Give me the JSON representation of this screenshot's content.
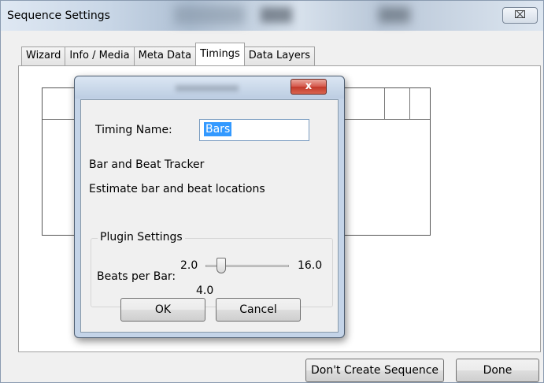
{
  "window": {
    "title": "Sequence Settings",
    "close_glyph": "⌧"
  },
  "tabs": [
    {
      "label": "Wizard",
      "active": false
    },
    {
      "label": "Info / Media",
      "active": false
    },
    {
      "label": "Meta Data",
      "active": false
    },
    {
      "label": "Timings",
      "active": true
    },
    {
      "label": "Data Layers",
      "active": false
    }
  ],
  "footer": {
    "dont_create_label": "Don't Create Sequence",
    "done_label": "Done"
  },
  "dialog": {
    "close_glyph": "x",
    "timing_name_label": "Timing Name:",
    "timing_name_value": "Bars",
    "plugin_name": "Bar and Beat Tracker",
    "plugin_description": "Estimate bar and beat locations",
    "settings_group_title": "Plugin Settings",
    "beats_label": "Beats per Bar:",
    "slider": {
      "min_label": "2.0",
      "max_label": "16.0",
      "value_label": "4.0",
      "min": 2.0,
      "max": 16.0,
      "value": 4.0
    },
    "ok_label": "OK",
    "cancel_label": "Cancel"
  },
  "colors": {
    "selection": "#3399ff",
    "close_button": "#c2382a",
    "dialog_frame": "#c4d4e8"
  }
}
